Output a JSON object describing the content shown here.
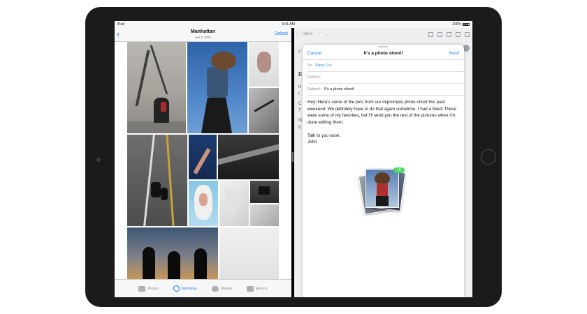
{
  "status_bar": {
    "device": "iPad",
    "time": "9:41 AM",
    "battery": "100%"
  },
  "photos": {
    "nav": {
      "back_label": "‹",
      "title": "Manhattan",
      "subtitle": "Jun 3, 2017",
      "select_label": "Select"
    },
    "tabs": [
      {
        "label": "Photos",
        "icon": "photos-icon",
        "active": false
      },
      {
        "label": "Memories",
        "icon": "memories-icon",
        "active": true
      },
      {
        "label": "Shared",
        "icon": "cloud-icon",
        "active": false
      },
      {
        "label": "Albums",
        "icon": "albums-icon",
        "active": false
      }
    ]
  },
  "mail": {
    "toolbar": {
      "inbox_label": "Inbox"
    },
    "background_letters": [
      "F",
      "E",
      "H",
      "I",
      "C",
      "T",
      "M",
      "D"
    ],
    "compose": {
      "cancel_label": "Cancel",
      "title": "It's a photo shoot!",
      "send_label": "Send",
      "to_label": "To:",
      "to_value": "Dana Cui",
      "cc_label": "Cc/Bcc:",
      "subject_label": "Subject:",
      "subject_value": "It's a photo shoot!",
      "body_paragraph_1": "Hey! Here's some of the pics from our impromptu photo shoot this past weekend. We definitely have to do that again sometime. I had a blast! These were some of my favorites, but I'll send you the rest of the pictures when I'm done editing them.",
      "body_sign_1": "Talk to you soon,",
      "body_sign_2": "John",
      "attachment_count": "+5"
    }
  },
  "colors": {
    "accent": "#1a7ff2",
    "badge_green": "#4cd964",
    "bezel": "#1b1b1c"
  }
}
